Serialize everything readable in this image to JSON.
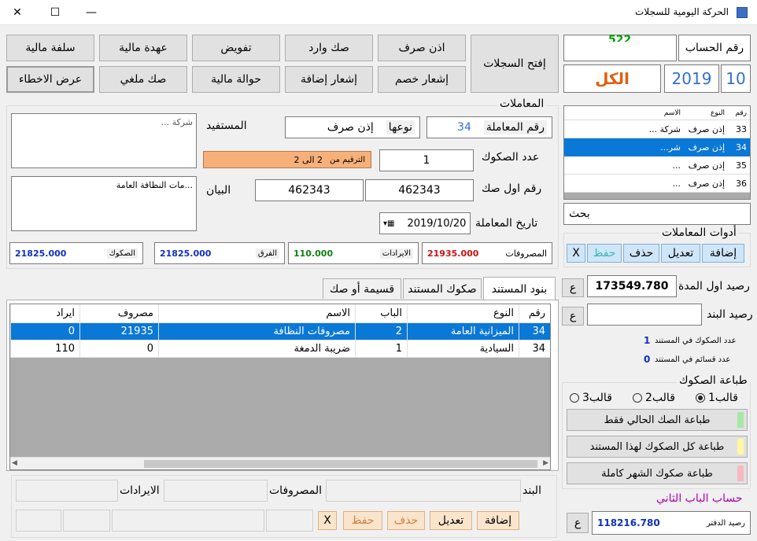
{
  "window": {
    "title": "الحركة اليومية للسجلات",
    "minimize": "—",
    "maximize": "☐",
    "close": "✕"
  },
  "top_buttons": {
    "row1": [
      "سلفة مالية",
      "عهدة مالية",
      "تفويض",
      "صك وارد",
      "اذن صرف"
    ],
    "row2": [
      "عرض الاخطاء",
      "صك ملغي",
      "حوالة مالية",
      "إشعار إضافة",
      "إشعار خصم"
    ],
    "open_records": "إفتح السجلات"
  },
  "account": {
    "label": "رقم الحساب",
    "value": "522",
    "all_label": "الكل",
    "year": "2019",
    "month": "10"
  },
  "transactions_list": {
    "headers": {
      "num": "رقم",
      "type": "النوع",
      "name": "الاسم"
    },
    "rows": [
      {
        "num": "33",
        "type": "إذن صرف",
        "name": "شركة ...",
        "selected": false
      },
      {
        "num": "34",
        "type": "إذن صرف",
        "name": "شر...",
        "selected": true
      },
      {
        "num": "35",
        "type": "إذن صرف",
        "name": "...",
        "selected": false
      },
      {
        "num": "36",
        "type": "إذن صرف",
        "name": "...",
        "selected": false
      }
    ],
    "search_label": "بحث"
  },
  "tools": {
    "title": "أدوات المعاملات",
    "add": "إضافة",
    "edit": "تعديل",
    "delete": "حذف",
    "save": "حفظ",
    "cancel": "X"
  },
  "transactions": {
    "group_title": "المعاملات",
    "txn_num_label": "رقم المعاملة",
    "txn_num": "34",
    "type_label": "نوعها",
    "type_value": "إذن صرف",
    "beneficiary_label": "المستفيد",
    "beneficiary_text": "شركة ...",
    "checks_count_label": "عدد الصكوك",
    "checks_count": "1",
    "numbering_prefix": "الترقيم من",
    "numbering_text": "2  الى  2",
    "first_check_label": "رقم اول صك",
    "first_check_a": "462343",
    "first_check_b": "462343",
    "statement_label": "البيان",
    "statement_text": "...مات النظافة العامة",
    "date_label": "تاريخ المعاملة",
    "date_value": "2019/10/20"
  },
  "totals": {
    "expenses_label": "المصروفات",
    "expenses": "21935.000",
    "revenues_label": "الايرادات",
    "revenues": "110.000",
    "diff_label": "الفرق",
    "diff": "21825.000",
    "checks_label": "الصكوك",
    "checks": "21825.000"
  },
  "tabs": [
    "بنود المستند",
    "صكوك المستند",
    "قسيمة أو صك"
  ],
  "items_grid": {
    "headers": {
      "num": "رقم",
      "type": "النوع",
      "chapter": "الباب",
      "name": "الاسم",
      "expense": "مصروف",
      "revenue": "ايراد"
    },
    "rows": [
      {
        "num": "34",
        "type": "الميزانية العامة",
        "chapter": "2",
        "name": "مصروفات النظافة",
        "expense": "21935",
        "revenue": "0",
        "selected": true
      },
      {
        "num": "34",
        "type": "السيادية",
        "chapter": "1",
        "name": "ضريبة الدمغة",
        "expense": "0",
        "revenue": "110",
        "selected": false
      }
    ]
  },
  "item_editor": {
    "item_label": "البند",
    "expenses_label": "المصروفات",
    "revenues_label": "الايرادات",
    "add": "إضافة",
    "edit": "تعديل",
    "delete": "حذف",
    "save": "حفظ",
    "cancel": "X"
  },
  "balances": {
    "opening_label": "رصيد اول المدة",
    "opening_value": "173549.780",
    "calc": "ع",
    "item_balance_label": "رصيد البند",
    "checks_in_doc_label": "عدد الصكوك في المستند",
    "checks_in_doc": "1",
    "coupons_in_doc_label": "عدد قسائم في المستند",
    "coupons_in_doc": "0"
  },
  "printing": {
    "title": "طباعة الصكوك",
    "templates": [
      "قالب1",
      "قالب2",
      "قالب3"
    ],
    "selected_template": "قالب1",
    "print_current": "طباعة الصك الحالي فقط",
    "print_all_doc": "طباعة كل الصكوك لهذا المستند",
    "print_month": "طباعة صكوك الشهر كاملة",
    "colors": {
      "current": "#a8e6a8",
      "all_doc": "#fff8a0",
      "month": "#f7b8c0"
    }
  },
  "second_chapter": {
    "title": "حساب الباب الثاني",
    "ledger_label": "رصيد الدفتر",
    "ledger_value": "118216.780",
    "calc": "ع"
  }
}
